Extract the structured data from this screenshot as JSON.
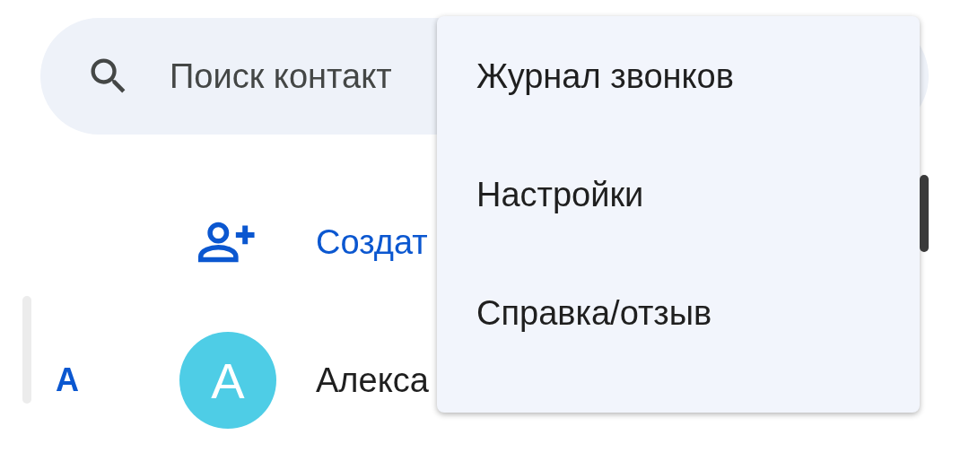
{
  "search": {
    "placeholder": "Поиск контакт"
  },
  "create_contact": {
    "label": "Создат"
  },
  "sections": [
    {
      "letter": "А",
      "contacts": [
        {
          "initial": "А",
          "name": "Алекса",
          "color": "#4ecde6"
        }
      ]
    }
  ],
  "menu": {
    "items": [
      {
        "label": "Журнал звонков"
      },
      {
        "label": "Настройки"
      },
      {
        "label": "Справка/отзыв"
      }
    ]
  }
}
